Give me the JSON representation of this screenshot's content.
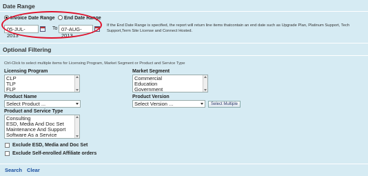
{
  "date_range": {
    "title": "Date Range",
    "invoice_label": "Invoice Date Range",
    "end_label": "End Date Range",
    "from_value": "05-JUL-2013",
    "to_label": "To",
    "to_value": "07-AUG-2013",
    "note": "If the End Date Range is specified, the report will return line items thatcontain an end date such as Upgrade Plan, Platinum Support, Tech Support,Term Site License and Connect Hosted."
  },
  "optional_filtering": {
    "title": "Optional Filtering",
    "hint": "Ctrl-Click to select multiple items for Licensing Program, Market Segment or Product and Service Type",
    "licensing_program": {
      "label": "Licensing Program",
      "options": [
        "CLP",
        "TLP",
        "FLP"
      ]
    },
    "market_segment": {
      "label": "Market Segment",
      "options": [
        "Commercial",
        "Education",
        "Government"
      ]
    },
    "product_name": {
      "label": "Product Name",
      "selected": "Select Product ..."
    },
    "product_version": {
      "label": "Product Version",
      "selected": "Select Version ...",
      "multiple_button": "Select Multiple"
    },
    "product_service_type": {
      "label": "Product and Service Type",
      "options": [
        "Consulting",
        "ESD, Media And Doc Set",
        "Maintenance And Support",
        "Software As a Service"
      ]
    },
    "exclude_esd": "Exclude ESD, Media and Doc Set",
    "exclude_self_enrolled": "Exclude Self-enrolled Affiliate orders"
  },
  "actions": {
    "search": "Search",
    "clear": "Clear"
  },
  "colors": {
    "background": "#d6ebf3",
    "highlight_ring": "#e0102a",
    "link": "#1a4fa0"
  }
}
